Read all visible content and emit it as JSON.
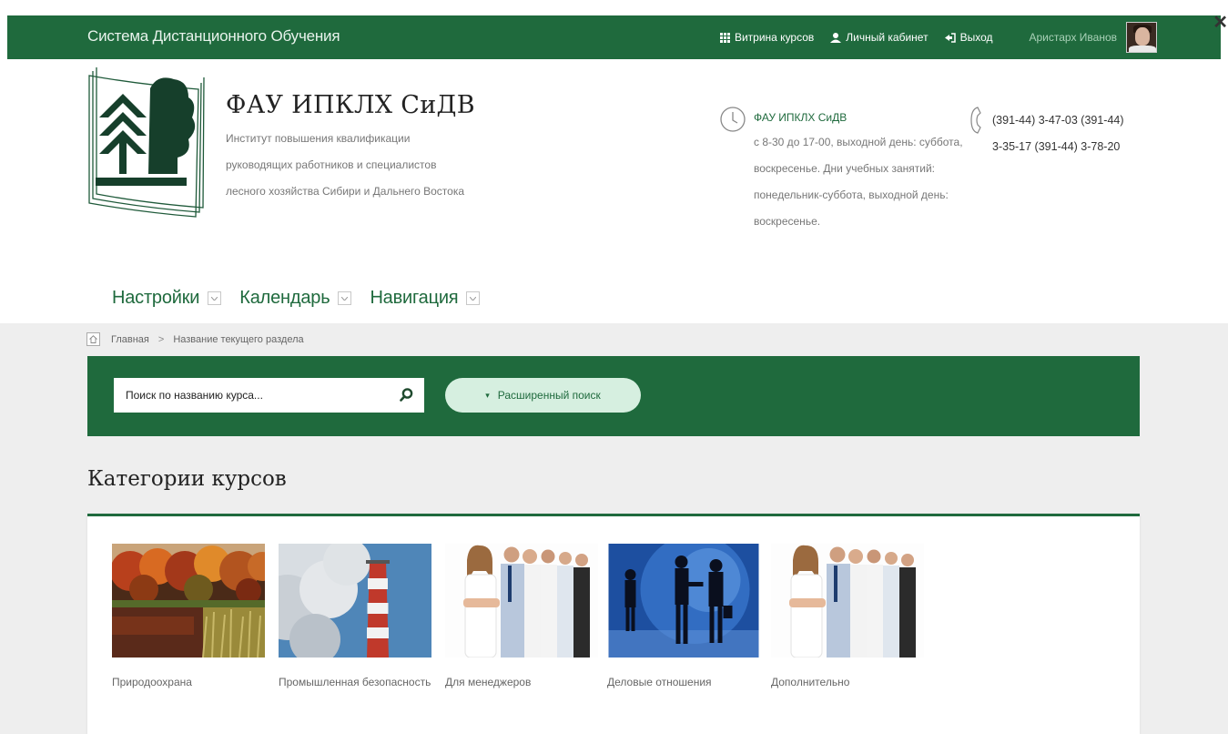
{
  "topbar": {
    "system_title": "Система Дистанционного Обучения",
    "nav": {
      "showcase": "Витрина курсов",
      "cabinet": "Личный кабинет",
      "logout": "Выход"
    },
    "user_name": "Аристарх Иванов",
    "close_glyph": "✕",
    "bar_color": "#1f6a3d"
  },
  "header": {
    "org_title": "ФАУ ИПКЛХ СиДВ",
    "org_subtitle_lines": [
      "Институт повышения квалификации",
      "руководящих работников и специалистов",
      "лесного хозяйства Сибири и Дальнего Востока"
    ],
    "contact_name": "ФАУ ИПКЛХ СиДВ",
    "contact_hours_lines": [
      "с 8-30 до 17-00, выходной день: суббота,",
      "воскресенье. Дни учебных занятий:",
      "понедельник-суббота, выходной день:",
      "воскресенье."
    ],
    "phone_lines": [
      "(391-44) 3-47-03 (391-44)",
      "3-35-17 (391-44) 3-78-20"
    ]
  },
  "menu": [
    {
      "label": "Настройки"
    },
    {
      "label": "Календарь"
    },
    {
      "label": "Навигация"
    }
  ],
  "breadcrumb": {
    "home": "Главная",
    "separator": ">",
    "current": "Название текущего раздела"
  },
  "search": {
    "placeholder": "Поиск по названию курса...",
    "advanced_label": "Расширенный поиск"
  },
  "categories": {
    "heading": "Категории курсов",
    "items": [
      {
        "label": "Природоохрана",
        "image": "autumn-lake-photo"
      },
      {
        "label": "Промышленная безопасность",
        "image": "factory-chimney-photo"
      },
      {
        "label": "Для менеджеров",
        "image": "business-team-photo"
      },
      {
        "label": "Деловые отношения",
        "image": "handshake-silhouettes-photo"
      },
      {
        "label": "Дополнительно",
        "image": "business-team-photo"
      }
    ]
  }
}
